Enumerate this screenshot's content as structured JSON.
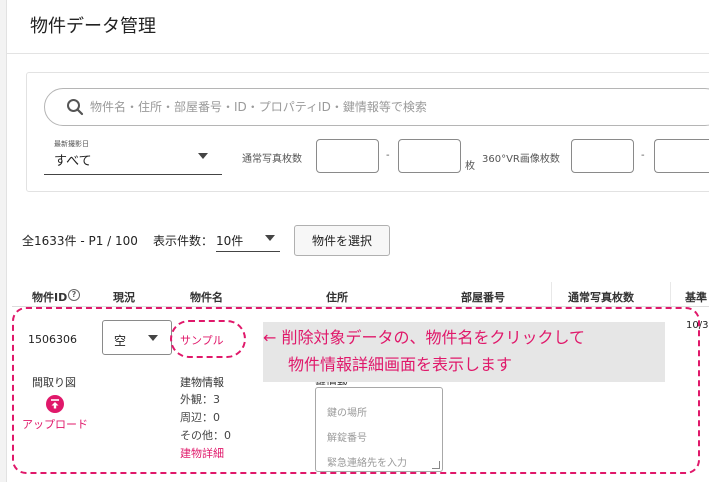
{
  "page": {
    "title": "物件データ管理"
  },
  "search": {
    "placeholder": "物件名・住所・部屋番号・ID・プロパティID・鍵情報等で検索",
    "value": ""
  },
  "filters": {
    "shoot_date": {
      "caption": "最新撮影日",
      "value": "すべて"
    },
    "photo_count_label": "通常写真枚数",
    "range_sep": "-",
    "unit": "枚",
    "vr_count_label": "360°VR画像枚数"
  },
  "pagination": {
    "summary": "全1633件 - P1 / 100",
    "per_page_label": "表示件数：",
    "per_page_value": "10件"
  },
  "toolbar": {
    "select_button": "物件を選択"
  },
  "table": {
    "headers": {
      "id": "物件ID",
      "status": "現況",
      "name": "物件名",
      "address": "住所",
      "room": "部屋番号",
      "photos": "通常写真枚数",
      "base": "基準"
    },
    "row": {
      "id": "1506306",
      "status": "空",
      "name": "サンプル",
      "base_value": "10/3",
      "floorplan_label": "間取り図",
      "upload_link": "アップロード",
      "building_title": "建物情報",
      "exterior": "外観：3",
      "surroundings": "周辺：0",
      "other": "その他：0",
      "building_detail_link": "建物詳細",
      "key_heading": "鍵情報",
      "key_location": "鍵の場所",
      "unlock_number": "解錠番号",
      "emergency_contact": "緊急連絡先を入力"
    }
  },
  "annotation": {
    "line1": "← 削除対象データの、物件名をクリックして",
    "line2": "物件情報詳細画面を表示します"
  },
  "colors": {
    "accent": "#e0186a",
    "annotation_bg": "#e6e6e6"
  }
}
